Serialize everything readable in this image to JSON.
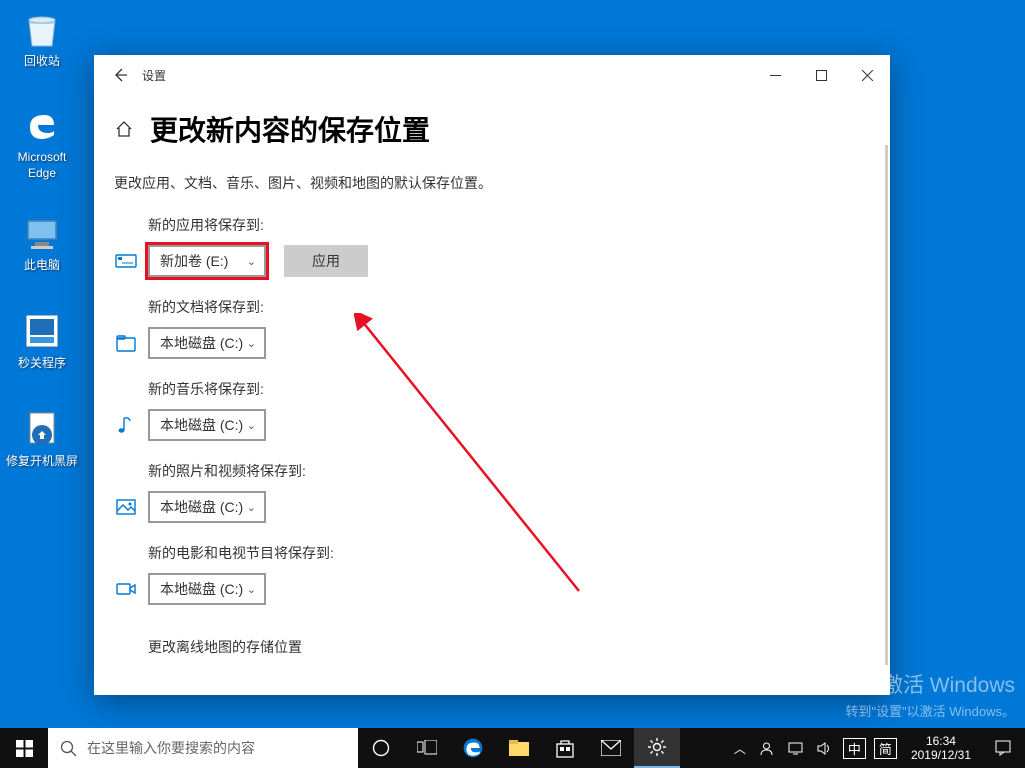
{
  "desktop": {
    "icons": [
      {
        "name": "recycle-bin",
        "label": "回收站"
      },
      {
        "name": "edge",
        "label": "Microsoft Edge"
      },
      {
        "name": "this-pc",
        "label": "此电脑"
      },
      {
        "name": "shutdown-prog",
        "label": "秒关程序"
      },
      {
        "name": "fix-boot",
        "label": "修复开机黑屏"
      }
    ]
  },
  "window": {
    "app_title": "设置",
    "page_title": "更改新内容的保存位置",
    "description": "更改应用、文档、音乐、图片、视频和地图的默认保存位置。",
    "apply": "应用",
    "sections": [
      {
        "label": "新的应用将保存到:",
        "value": "新加卷 (E:)",
        "highlight": true,
        "has_apply": true
      },
      {
        "label": "新的文档将保存到:",
        "value": "本地磁盘 (C:)"
      },
      {
        "label": "新的音乐将保存到:",
        "value": "本地磁盘 (C:)"
      },
      {
        "label": "新的照片和视频将保存到:",
        "value": "本地磁盘 (C:)"
      },
      {
        "label": "新的电影和电视节目将保存到:",
        "value": "本地磁盘 (C:)"
      }
    ],
    "bottom_link": "更改离线地图的存储位置"
  },
  "watermark": {
    "line1": "激活 Windows",
    "line2": "转到\"设置\"以激活 Windows。"
  },
  "taskbar": {
    "search_placeholder": "在这里输入你要搜索的内容",
    "ime": "中",
    "ime2": "简",
    "time": "16:34",
    "date": "2019/12/31"
  }
}
